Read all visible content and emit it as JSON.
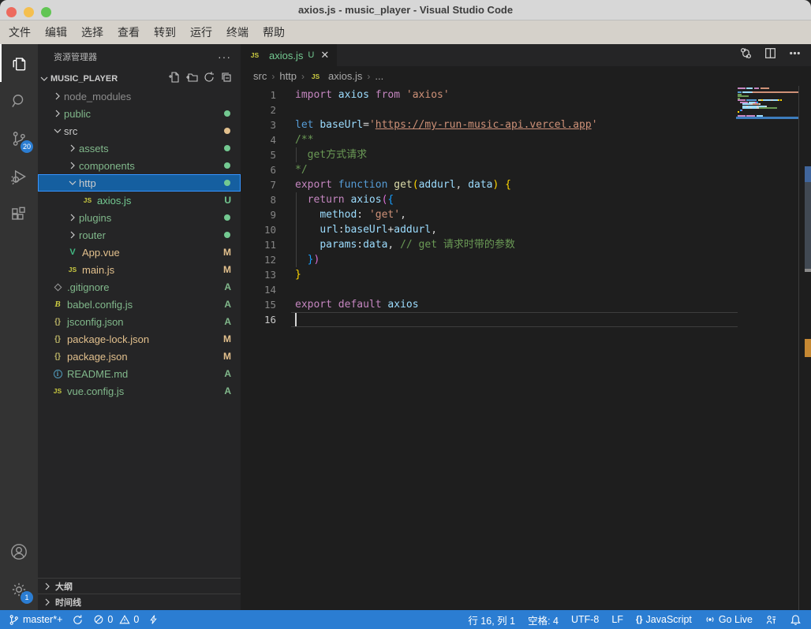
{
  "window": {
    "title": "axios.js - music_player - Visual Studio Code"
  },
  "menu": {
    "items": [
      "文件",
      "编辑",
      "选择",
      "查看",
      "转到",
      "运行",
      "终端",
      "帮助"
    ]
  },
  "activity_bar": {
    "source_control_badge": "20",
    "settings_badge": "1"
  },
  "sidebar": {
    "header_title": "资源管理器",
    "more_label": "···",
    "project": "MUSIC_PLAYER",
    "tree": [
      {
        "label": "node_modules",
        "chevron": "right",
        "cls": "ignored",
        "indent": 1
      },
      {
        "label": "public",
        "chevron": "right",
        "cls": "added",
        "indent": 1,
        "badge": {
          "type": "dot",
          "cls": "untracked"
        }
      },
      {
        "label": "src",
        "chevron": "down",
        "cls": "default",
        "indent": 1,
        "badge": {
          "type": "dot",
          "cls": "modified"
        }
      },
      {
        "label": "assets",
        "chevron": "right",
        "cls": "added",
        "indent": 2,
        "badge": {
          "type": "dot",
          "cls": "untracked"
        }
      },
      {
        "label": "components",
        "chevron": "right",
        "cls": "added",
        "indent": 2,
        "badge": {
          "type": "dot",
          "cls": "untracked"
        }
      },
      {
        "label": "http",
        "chevron": "down",
        "cls": "default",
        "indent": 2,
        "selected": true,
        "badge": {
          "type": "dot",
          "cls": "untracked"
        }
      },
      {
        "label": "axios.js",
        "icon": "js",
        "cls": "untracked",
        "indent": 3,
        "badge": {
          "type": "letter",
          "text": "U",
          "cls": "untracked"
        }
      },
      {
        "label": "plugins",
        "chevron": "right",
        "cls": "added",
        "indent": 2,
        "badge": {
          "type": "dot",
          "cls": "untracked"
        }
      },
      {
        "label": "router",
        "chevron": "right",
        "cls": "added",
        "indent": 2,
        "badge": {
          "type": "dot",
          "cls": "untracked"
        }
      },
      {
        "label": "App.vue",
        "icon": "vue",
        "cls": "modified",
        "indent": 2,
        "badge": {
          "type": "letter",
          "text": "M",
          "cls": "modified"
        }
      },
      {
        "label": "main.js",
        "icon": "js",
        "cls": "modified",
        "indent": 2,
        "badge": {
          "type": "letter",
          "text": "M",
          "cls": "modified"
        }
      },
      {
        "label": ".gitignore",
        "icon": "git",
        "cls": "added",
        "indent": 1,
        "badge": {
          "type": "letter",
          "text": "A",
          "cls": "added"
        }
      },
      {
        "label": "babel.config.js",
        "icon": "babel",
        "cls": "added",
        "indent": 1,
        "badge": {
          "type": "letter",
          "text": "A",
          "cls": "added"
        }
      },
      {
        "label": "jsconfig.json",
        "icon": "json",
        "cls": "added",
        "indent": 1,
        "badge": {
          "type": "letter",
          "text": "A",
          "cls": "added"
        }
      },
      {
        "label": "package-lock.json",
        "icon": "json",
        "cls": "modified",
        "indent": 1,
        "badge": {
          "type": "letter",
          "text": "M",
          "cls": "modified"
        }
      },
      {
        "label": "package.json",
        "icon": "json",
        "cls": "modified",
        "indent": 1,
        "badge": {
          "type": "letter",
          "text": "M",
          "cls": "modified"
        }
      },
      {
        "label": "README.md",
        "icon": "info",
        "cls": "added",
        "indent": 1,
        "badge": {
          "type": "letter",
          "text": "A",
          "cls": "added"
        }
      },
      {
        "label": "vue.config.js",
        "icon": "js",
        "cls": "added",
        "indent": 1,
        "badge": {
          "type": "letter",
          "text": "A",
          "cls": "added"
        }
      }
    ],
    "panels": {
      "outline": "大纲",
      "timeline": "时间线"
    }
  },
  "editor": {
    "tab": {
      "label": "axios.js",
      "git_status": "U",
      "close": "✕"
    },
    "breadcrumbs": [
      {
        "label": "src"
      },
      {
        "label": "http"
      },
      {
        "label": "axios.js",
        "icon": "js"
      },
      {
        "label": "..."
      }
    ],
    "code": {
      "lines": [
        {
          "n": 1,
          "tokens": [
            {
              "t": "import",
              "c": "kw2"
            },
            {
              "t": " ",
              "c": "pl"
            },
            {
              "t": "axios",
              "c": "var"
            },
            {
              "t": " ",
              "c": "pl"
            },
            {
              "t": "from",
              "c": "kw2"
            },
            {
              "t": " ",
              "c": "pl"
            },
            {
              "t": "'axios'",
              "c": "str"
            }
          ]
        },
        {
          "n": 2,
          "tokens": []
        },
        {
          "n": 3,
          "tokens": [
            {
              "t": "let",
              "c": "kw"
            },
            {
              "t": " ",
              "c": "pl"
            },
            {
              "t": "baseUrl",
              "c": "var"
            },
            {
              "t": "=",
              "c": "pl"
            },
            {
              "t": "'",
              "c": "str"
            },
            {
              "t": "https://my-run-music-api.vercel.app",
              "c": "url"
            },
            {
              "t": "'",
              "c": "str"
            }
          ]
        },
        {
          "n": 4,
          "tokens": [
            {
              "t": "/**",
              "c": "com"
            }
          ]
        },
        {
          "n": 5,
          "guide": true,
          "tokens": [
            {
              "t": "  get方式请求",
              "c": "com"
            }
          ]
        },
        {
          "n": 6,
          "tokens": [
            {
              "t": "*/",
              "c": "com"
            }
          ]
        },
        {
          "n": 7,
          "tokens": [
            {
              "t": "export",
              "c": "kw2"
            },
            {
              "t": " ",
              "c": "pl"
            },
            {
              "t": "function",
              "c": "kw"
            },
            {
              "t": " ",
              "c": "pl"
            },
            {
              "t": "get",
              "c": "fn"
            },
            {
              "t": "(",
              "c": "b1"
            },
            {
              "t": "addurl",
              "c": "var"
            },
            {
              "t": ", ",
              "c": "pl"
            },
            {
              "t": "data",
              "c": "var"
            },
            {
              "t": ")",
              "c": "b1"
            },
            {
              "t": " ",
              "c": "pl"
            },
            {
              "t": "{",
              "c": "b1"
            }
          ]
        },
        {
          "n": 8,
          "guide": true,
          "tokens": [
            {
              "t": "  ",
              "c": "pl"
            },
            {
              "t": "return",
              "c": "kw2"
            },
            {
              "t": " ",
              "c": "pl"
            },
            {
              "t": "axios",
              "c": "var"
            },
            {
              "t": "(",
              "c": "b2"
            },
            {
              "t": "{",
              "c": "b3"
            }
          ]
        },
        {
          "n": 9,
          "guide": true,
          "tokens": [
            {
              "t": "    ",
              "c": "pl"
            },
            {
              "t": "method",
              "c": "var"
            },
            {
              "t": ": ",
              "c": "pl"
            },
            {
              "t": "'get'",
              "c": "str"
            },
            {
              "t": ",",
              "c": "pl"
            }
          ]
        },
        {
          "n": 10,
          "guide": true,
          "tokens": [
            {
              "t": "    ",
              "c": "pl"
            },
            {
              "t": "url",
              "c": "var"
            },
            {
              "t": ":",
              "c": "pl"
            },
            {
              "t": "baseUrl",
              "c": "var"
            },
            {
              "t": "+",
              "c": "pl"
            },
            {
              "t": "addurl",
              "c": "var"
            },
            {
              "t": ",",
              "c": "pl"
            }
          ]
        },
        {
          "n": 11,
          "guide": true,
          "tokens": [
            {
              "t": "    ",
              "c": "pl"
            },
            {
              "t": "params",
              "c": "var"
            },
            {
              "t": ":",
              "c": "pl"
            },
            {
              "t": "data",
              "c": "var"
            },
            {
              "t": ", ",
              "c": "pl"
            },
            {
              "t": "// get 请求时带的参数",
              "c": "com"
            }
          ]
        },
        {
          "n": 12,
          "guide": true,
          "tokens": [
            {
              "t": "  ",
              "c": "pl"
            },
            {
              "t": "}",
              "c": "b3"
            },
            {
              "t": ")",
              "c": "b2"
            }
          ]
        },
        {
          "n": 13,
          "tokens": [
            {
              "t": "}",
              "c": "b1"
            }
          ]
        },
        {
          "n": 14,
          "tokens": []
        },
        {
          "n": 15,
          "tokens": [
            {
              "t": "export",
              "c": "kw2"
            },
            {
              "t": " ",
              "c": "pl"
            },
            {
              "t": "default",
              "c": "kw2"
            },
            {
              "t": " ",
              "c": "pl"
            },
            {
              "t": "axios",
              "c": "var"
            }
          ]
        },
        {
          "n": 16,
          "current": true,
          "tokens": []
        }
      ]
    }
  },
  "status_bar": {
    "branch": "master*+",
    "errors": "0",
    "warnings": "0",
    "cursor": "行 16, 列 1",
    "indent": "空格: 4",
    "encoding": "UTF-8",
    "eol": "LF",
    "language_icon": "{}",
    "language": "JavaScript",
    "live": "Go Live"
  },
  "colors": {
    "accent": "#2b7dd2",
    "tokens": {
      "kw": "#569cd6",
      "kw2": "#c586c0",
      "var": "#9cdcfe",
      "str": "#ce9178",
      "url": "#ce9178",
      "com": "#6a9955",
      "fn": "#dcdcaa",
      "pl": "#d4d4d4",
      "b1": "#ffd700",
      "b2": "#da70d6",
      "b3": "#179fff"
    },
    "ruler_marks": [
      "#40659c",
      "#64748880",
      "#8a8a8a",
      "#c58833"
    ]
  }
}
